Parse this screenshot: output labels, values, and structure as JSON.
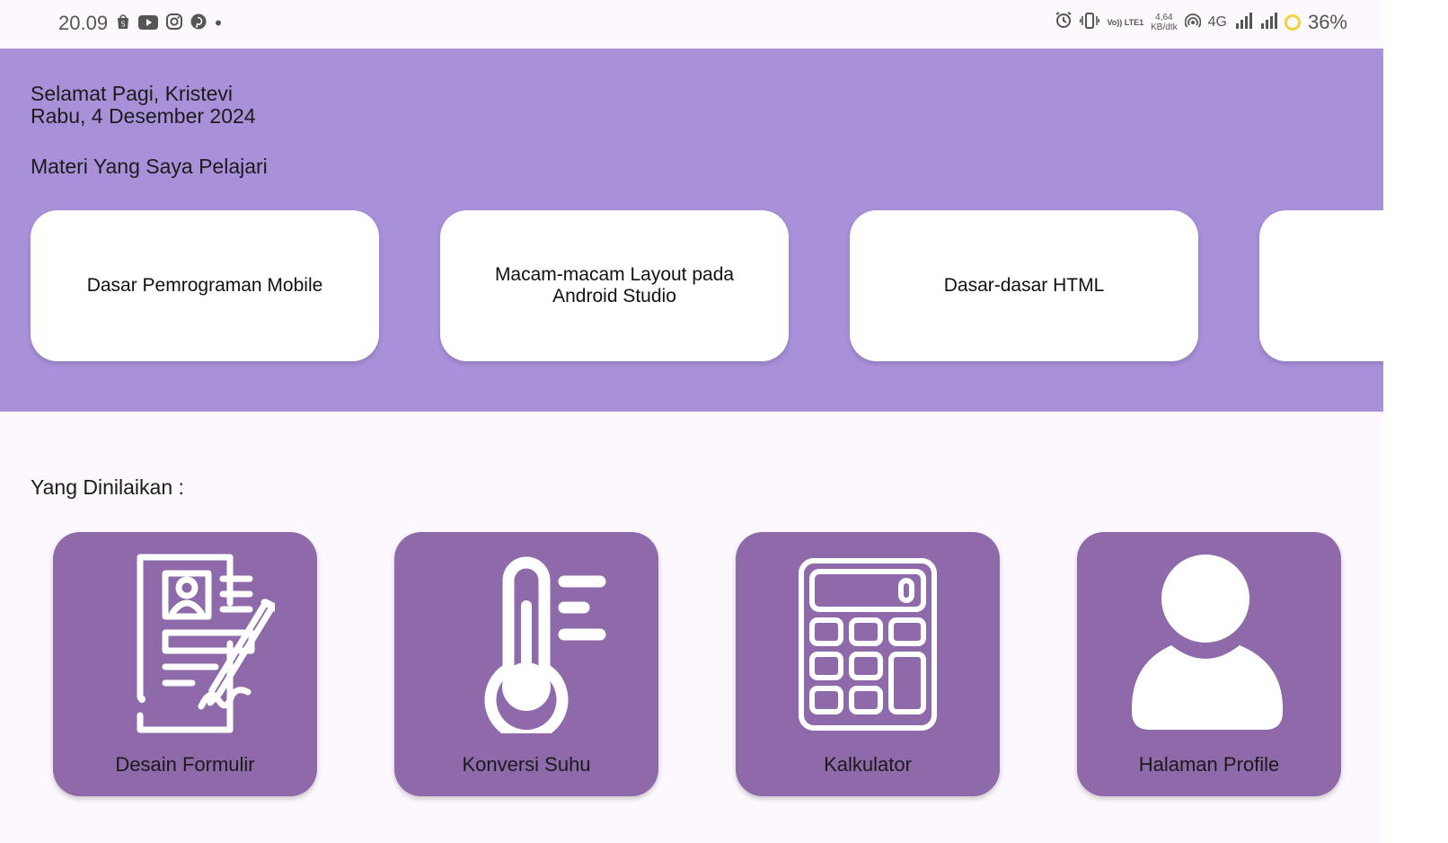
{
  "statusbar": {
    "time": "20.09",
    "notification_icons": [
      "shopee-icon",
      "youtube-icon",
      "instagram-icon",
      "pinterest-icon"
    ],
    "dot": "•",
    "volte_label": "Vo)) LTE1",
    "net_speed_value": "4,64",
    "net_speed_unit": "KB/dtk",
    "network_type": "4G",
    "battery": "36%"
  },
  "header": {
    "greeting": "Selamat Pagi, Kristevi",
    "date": "Rabu, 4 Desember 2024"
  },
  "materials": {
    "title": "Materi Yang Saya Pelajari",
    "items": [
      {
        "label": "Dasar Pemrograman Mobile"
      },
      {
        "label": "Macam-macam Layout pada Android Studio"
      },
      {
        "label": "Dasar-dasar HTML"
      },
      {
        "label": ""
      }
    ]
  },
  "assessed": {
    "title": "Yang Dinilaikan :",
    "items": [
      {
        "label": "Desain Formulir",
        "icon": "form-signature-icon"
      },
      {
        "label": "Konversi Suhu",
        "icon": "thermometer-icon"
      },
      {
        "label": "Kalkulator",
        "icon": "calculator-icon"
      },
      {
        "label": "Halaman Profile",
        "icon": "user-profile-icon"
      }
    ]
  },
  "colors": {
    "hero_bg": "#a991da",
    "tile_bg": "#8e6aab",
    "card_bg": "#ffffff",
    "page_bg": "#fdf8fd"
  }
}
